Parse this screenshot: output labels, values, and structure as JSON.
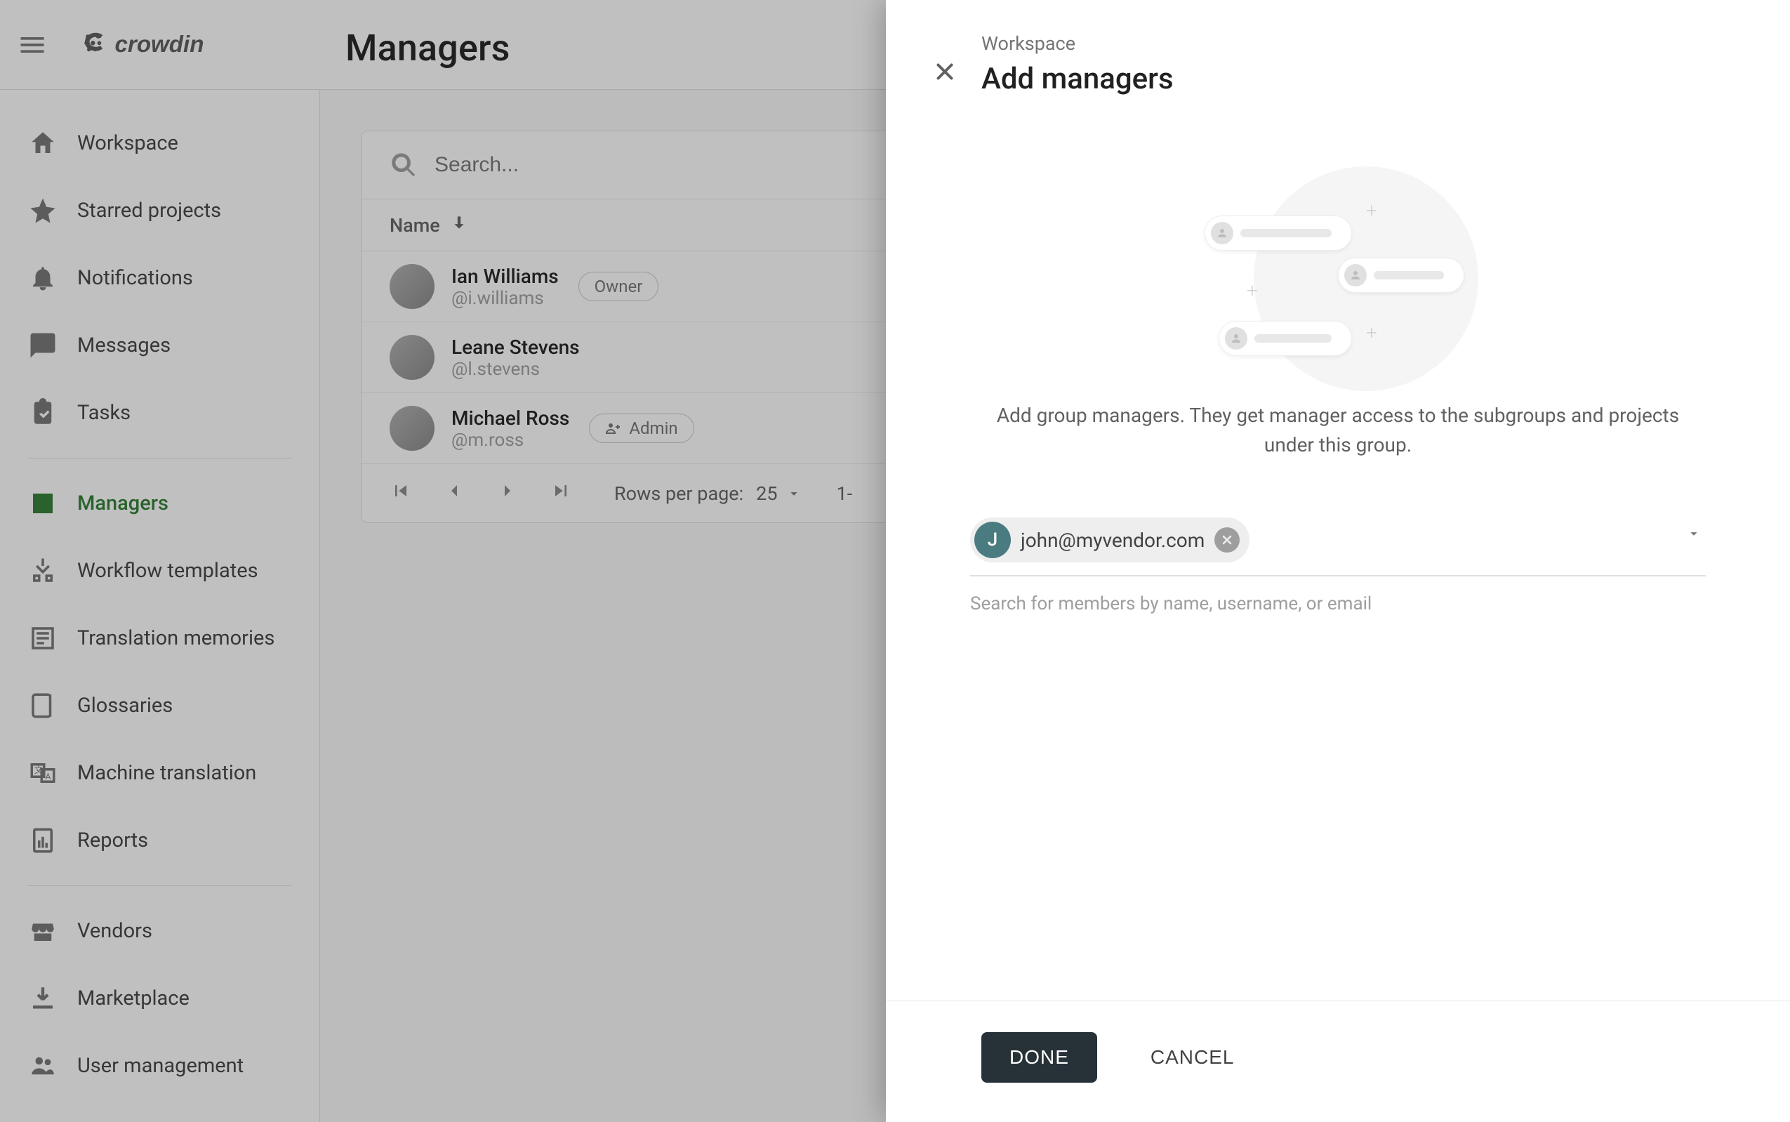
{
  "header": {
    "page_title": "Managers",
    "brand": "crowdin"
  },
  "sidebar": {
    "items": [
      {
        "label": "Workspace",
        "icon": "home-icon"
      },
      {
        "label": "Starred projects",
        "icon": "star-icon"
      },
      {
        "label": "Notifications",
        "icon": "bell-icon"
      },
      {
        "label": "Messages",
        "icon": "chat-icon"
      },
      {
        "label": "Tasks",
        "icon": "clipboard-icon"
      },
      {
        "label": "Managers",
        "icon": "badge-icon",
        "active": true
      },
      {
        "label": "Workflow templates",
        "icon": "workflow-icon"
      },
      {
        "label": "Translation memories",
        "icon": "tm-icon"
      },
      {
        "label": "Glossaries",
        "icon": "glossary-icon"
      },
      {
        "label": "Machine translation",
        "icon": "mt-icon"
      },
      {
        "label": "Reports",
        "icon": "reports-icon"
      },
      {
        "label": "Vendors",
        "icon": "store-icon"
      },
      {
        "label": "Marketplace",
        "icon": "download-icon"
      },
      {
        "label": "User management",
        "icon": "people-icon"
      }
    ]
  },
  "table": {
    "search_placeholder": "Search...",
    "name_header": "Name",
    "rows": [
      {
        "name": "Ian Williams",
        "handle": "@i.williams",
        "badge": "Owner"
      },
      {
        "name": "Leane Stevens",
        "handle": "@l.stevens",
        "badge": null
      },
      {
        "name": "Michael Ross",
        "handle": "@m.ross",
        "badge": "Admin",
        "badge_icon": true
      }
    ],
    "pager": {
      "rows_per_page_label": "Rows per page:",
      "rows_per_page_value": "25",
      "range_prefix": "1-"
    }
  },
  "sheet": {
    "breadcrumb": "Workspace",
    "title": "Add managers",
    "description": "Add group managers. They get manager access to the subgroups and projects under this group.",
    "chip": {
      "initial": "J",
      "text": "john@myvendor.com"
    },
    "helper": "Search for members by name, username, or email",
    "done_label": "DONE",
    "cancel_label": "CANCEL"
  }
}
